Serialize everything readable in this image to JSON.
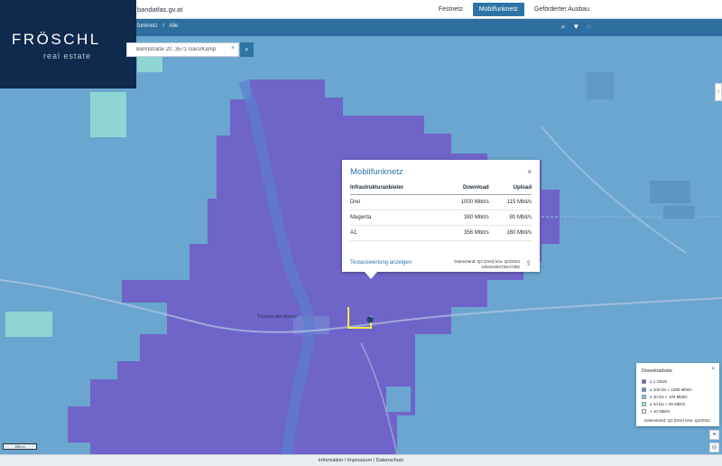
{
  "header": {
    "site_name": "bandatlas.gv.at",
    "tabs": [
      {
        "label": "Festnetz",
        "active": false
      },
      {
        "label": "Mobilfunknetz",
        "active": true
      },
      {
        "label": "Geförderter Ausbau",
        "active": false
      }
    ]
  },
  "subbar": {
    "breadcrumb": [
      "funknetz",
      "/",
      "Alle"
    ],
    "icons": [
      "search-icon",
      "filter-icon",
      "layers-icon"
    ]
  },
  "logo": {
    "wordmark": "FRÖSCHL",
    "sub": "real estate"
  },
  "search": {
    "value": "Bahnstraße 20, 3571 Gars/Kamp",
    "clear_glyph": "×",
    "button_glyph": "⌕"
  },
  "popup": {
    "title": "Mobilfunknetz",
    "close_glyph": "×",
    "columns": [
      "Infrastrukturanbieter",
      "Download",
      "Upload"
    ],
    "rows": [
      [
        "Drei",
        "1000 Mbit/s",
        "115 Mbit/s"
      ],
      [
        "Magenta",
        "380 Mbit/s",
        "80 Mbit/s"
      ],
      [
        "A1",
        "356 Mbit/s",
        "160 Mbit/s"
      ]
    ],
    "link": "Testauswertung anzeigen",
    "stand": "Datenstand: Q3 (Drei) bzw. Q4/2024",
    "stand_id": "100mN2847SE47382",
    "share_glyph": "⇪"
  },
  "legend": {
    "title": "Downloadrate",
    "close_glyph": "×",
    "items": [
      {
        "label": "≥ 1 Gbit/s",
        "color": "#6f5cc8"
      },
      {
        "label": "≥ 100 bis < 1000 Mbit/s",
        "color": "#6a84d6"
      },
      {
        "label": "≥ 30 bis < 100 Mbit/s",
        "color": "#7cc4e2"
      },
      {
        "label": "≥ 10 bis < 30 Mbit/s",
        "color": "#a8e6d2"
      },
      {
        "label": "< 10 Mbit/s",
        "color": "#f6f7ec"
      }
    ],
    "stand": "Datenstand: Q3 (Drei) bzw. Q4/2024"
  },
  "map": {
    "scale": "200 m",
    "controls": [
      "menu-icon",
      "locate-icon"
    ],
    "side_toggle_glyph": "‹",
    "place_labels": [
      "Thunau am Kamp"
    ]
  },
  "footer": {
    "text": "Information / Impressum / Datenschutz"
  },
  "colors": {
    "accent": "#2f73a6",
    "coverage_high": "#6f5cc8",
    "coverage_mid": "#6aa6cf",
    "coverage_low": "#8fd6d3"
  }
}
